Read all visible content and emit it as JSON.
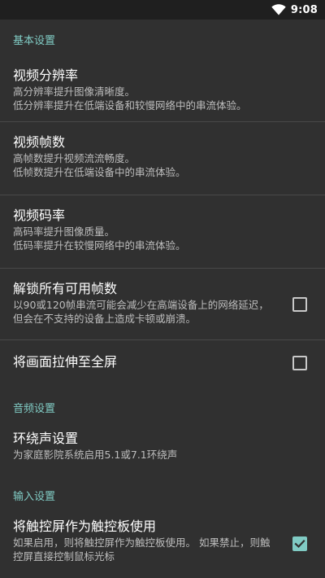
{
  "status_bar": {
    "time": "9:08"
  },
  "sections": {
    "basic": {
      "header": "基本设置",
      "resolution": {
        "title": "视频分辨率",
        "summary": "高分辨率提升图像清晰度。\n 低分辨率提升在低端设备和较慢网络中的串流体验。"
      },
      "framerate": {
        "title": "视频帧数",
        "summary": "高帧数提升视频流流畅度。\n 低帧数提升在低端设备中的串流体验。"
      },
      "bitrate": {
        "title": "视频码率",
        "summary": "高码率提升图像质量。\n 低码率提升在较慢网络中的串流体验。"
      },
      "unlock_fps": {
        "title": "解锁所有可用帧数",
        "summary": "以90或120帧串流可能会减少在高端设备上的网络延迟，但会在不支持的设备上造成卡顿或崩溃。",
        "checked": false
      },
      "stretch": {
        "title": "将画面拉伸至全屏",
        "checked": false
      }
    },
    "audio": {
      "header": "音频设置",
      "surround": {
        "title": "环绕声设置",
        "summary": "为家庭影院系统启用5.1或7.1环绕声"
      }
    },
    "input": {
      "header": "输入设置",
      "touchpad": {
        "title": "将触控屏作为触控板使用",
        "summary": "如果启用，则将触控屏作为触控板使用。 如果禁止，则触控屏直接控制鼠标光标",
        "checked": true
      }
    }
  },
  "colors": {
    "accent": "#80cbc4",
    "background": "#303030",
    "statusbar": "#1f1f1f"
  },
  "icons": {
    "wifi": "wifi-icon",
    "check": "check-icon"
  }
}
